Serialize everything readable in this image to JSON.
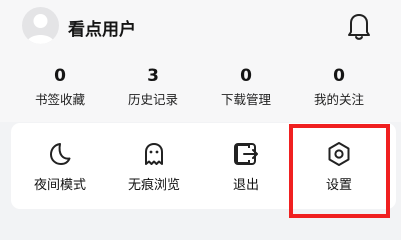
{
  "header": {
    "username": "看点用户",
    "avatar_icon": "default-avatar-icon",
    "bell_icon": "bell-icon"
  },
  "stats": [
    {
      "count": "0",
      "label": "书签收藏"
    },
    {
      "count": "3",
      "label": "历史记录"
    },
    {
      "count": "0",
      "label": "下载管理"
    },
    {
      "count": "0",
      "label": "我的关注"
    }
  ],
  "menu": [
    {
      "label": "夜间模式",
      "icon": "moon-icon"
    },
    {
      "label": "无痕浏览",
      "icon": "ghost-icon"
    },
    {
      "label": "退出",
      "icon": "exit-icon"
    },
    {
      "label": "设置",
      "icon": "settings-hexagon-icon"
    }
  ],
  "colors": {
    "background": "#f2f3f5",
    "card": "#ffffff",
    "highlight": "#f02020"
  }
}
